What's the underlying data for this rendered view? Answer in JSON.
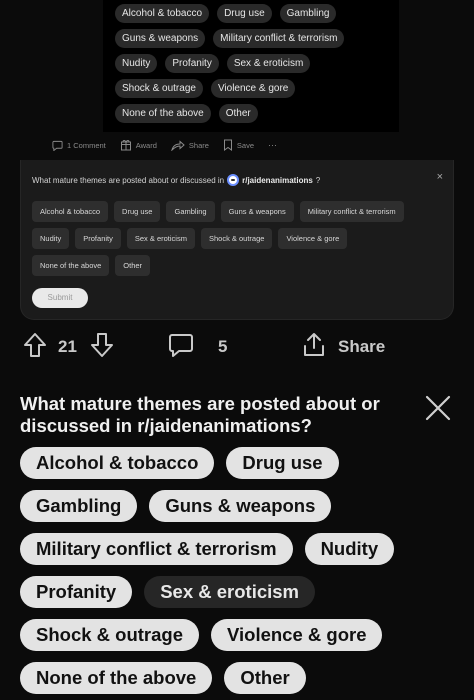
{
  "post_image": {
    "rows": [
      [
        "Alcohol & tobacco",
        "Drug use",
        "Gambling"
      ],
      [
        "Guns & weapons",
        "Military conflict & terrorism"
      ],
      [
        "Nudity",
        "Profanity",
        "Sex & eroticism"
      ],
      [
        "Shock & outrage",
        "Violence & gore"
      ],
      [
        "None of the above",
        "Other"
      ]
    ]
  },
  "small_actions": {
    "comment": "1 Comment",
    "award": "Award",
    "share": "Share",
    "save": "Save",
    "more": "···"
  },
  "card": {
    "question_prefix": "What mature themes are posted about or discussed in",
    "subreddit": "r/jaidenanimations",
    "question_suffix": "?",
    "close": "×",
    "rows": [
      [
        "Alcohol & tobacco",
        "Drug use",
        "Gambling",
        "Guns & weapons",
        "Military conflict & terrorism"
      ],
      [
        "Nudity",
        "Profanity",
        "Sex & eroticism",
        "Shock & outrage",
        "Violence & gore"
      ],
      [
        "None of the above",
        "Other"
      ]
    ],
    "submit": "Submit"
  },
  "action_bar": {
    "upvotes": "21",
    "comments": "5",
    "share": "Share"
  },
  "big_question": {
    "text": "What mature themes are posted about or discussed in r/jaidenanimations?",
    "rows": [
      [
        {
          "label": "Alcohol & tobacco",
          "selected": false
        },
        {
          "label": "Drug use",
          "selected": false
        }
      ],
      [
        {
          "label": "Gambling",
          "selected": false
        },
        {
          "label": "Guns & weapons",
          "selected": false
        }
      ],
      [
        {
          "label": "Military conflict & terrorism",
          "selected": false
        },
        {
          "label": "Nudity",
          "selected": false
        }
      ],
      [
        {
          "label": "Profanity",
          "selected": false
        },
        {
          "label": "Sex & eroticism",
          "selected": true
        }
      ],
      [
        {
          "label": "Shock & outrage",
          "selected": false
        },
        {
          "label": "Violence & gore",
          "selected": false
        }
      ],
      [
        {
          "label": "None of the above",
          "selected": false
        },
        {
          "label": "Other",
          "selected": false
        }
      ]
    ]
  },
  "colors": {
    "background": "#0b0b0b",
    "card": "#1b1b1b",
    "chip_light": "#e3e3e3",
    "chip_dark": "#262626"
  }
}
